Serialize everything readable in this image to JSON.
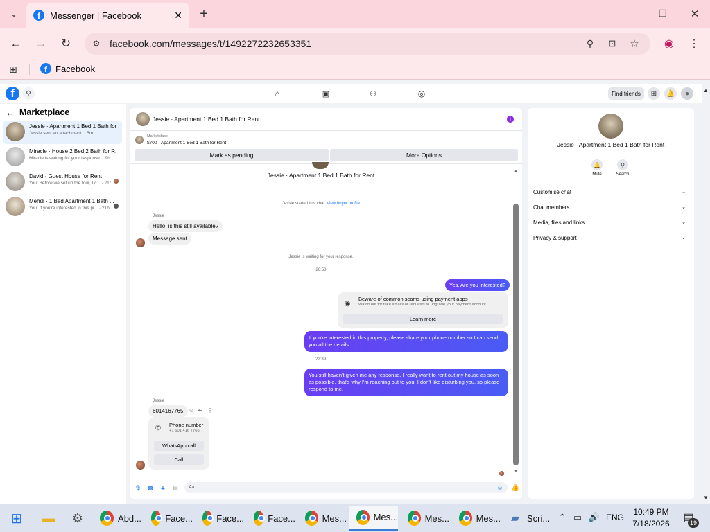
{
  "browser": {
    "tab_title": "Messenger | Facebook",
    "url": "facebook.com/messages/t/1492272232653351",
    "bookmark_label": "Facebook"
  },
  "fb": {
    "find_friends": "Find friends"
  },
  "sidebar": {
    "title": "Marketplace",
    "conversations": [
      {
        "title": "Jessie · Apartment 1 Bed 1 Bath for...",
        "preview": "Jessie sent an attachment. · 5m"
      },
      {
        "title": "Miracle · House 2 Bed 2 Bath for R...",
        "preview": "Miracle is waiting for your response. · 9h"
      },
      {
        "title": "David · Guest House for Rent",
        "preview": "You: Before we set up the tour, I c...  · 21h"
      },
      {
        "title": "Mehdi · 1 Bed Apartment 1 Bath ...",
        "preview": "You: If you're interested in this pr...  · 21h"
      }
    ]
  },
  "chat": {
    "header_title": "Jessie · Apartment 1 Bed 1 Bath for Rent",
    "listing_label": "Marketplace",
    "listing_desc": "$700 · Apartment 1 Bed 1 Bath for Rent",
    "mark_pending": "Mark as pending",
    "more_options": "More Options",
    "top_title": "Jessie · Apartment 1 Bed 1 Bath for Rent",
    "started": "Jessie started this chat.",
    "view_buyer": "View buyer profile",
    "sender_name": "Jessie",
    "msg_hello": "Hello, is this still available?",
    "msg_sent": "Message sent",
    "waiting": "Jessie is waiting for your response.",
    "time1": "20:50",
    "out1": "Yes. Are you interested?",
    "scam_title": "Beware of common scams using payment apps",
    "scam_desc": "Watch out for fake emails or requests to upgrade your payment account.",
    "learn_more": "Learn more",
    "out2": "If you're interested in this property, please share your phone number so I can send you all the details.",
    "time2": "22:39",
    "out3": "You still haven't given me any response. I really want to rent out my house as soon as possible, that's why I'm reaching out to you. I don't like disturbing you, so please respond to me.",
    "sender_name2": "Jessie",
    "phone_msg": "6014167765",
    "phone_card_title": "Phone number",
    "phone_card_num": "+1 601 416 7765",
    "whatsapp_call": "WhatsApp call",
    "call": "Call",
    "input_placeholder": "Aa"
  },
  "info": {
    "title": "Jessie · Apartment 1 Bed 1 Bath for Rent",
    "mute": "Mute",
    "search": "Search",
    "rows": [
      "Customise chat",
      "Chat members",
      "Media, files and links",
      "Privacy & support"
    ]
  },
  "taskbar": {
    "items": [
      "Abd...",
      "Face...",
      "Face...",
      "Face...",
      "Mes...",
      "Mes...",
      "Mes...",
      "Mes...",
      "Scri..."
    ],
    "lang": "ENG",
    "time": "10:49 PM",
    "date": "7/18/2026",
    "notif_count": "19"
  },
  "colors": {
    "accent": "#1877f2",
    "bubble_out": "#5b4cf2",
    "tab_bg": "#fbd6dc"
  }
}
